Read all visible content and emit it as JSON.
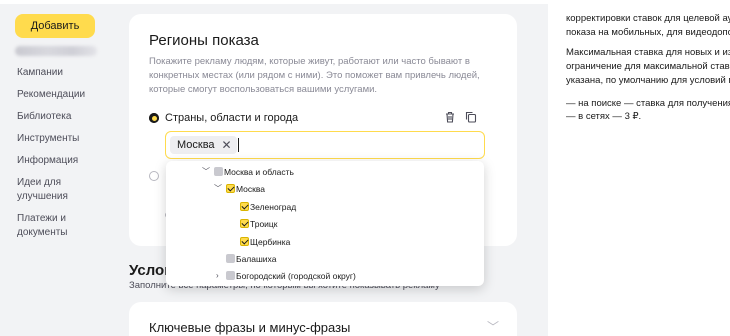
{
  "sidebar": {
    "add_label": "Добавить",
    "nav": [
      "Кампании",
      "Рекомендации",
      "Библиотека",
      "Инструменты",
      "Информация",
      "Идеи для улучшения",
      "Платежи и документы"
    ]
  },
  "regions": {
    "title": "Регионы показа",
    "description": "Покажите рекламу людям, которые живут, работают или часто бывают в конкретных местах (или рядом с ними). Это поможет вам привлечь людей, которые смогут воспользоваться вашими услугами.",
    "option_label": "Страны, области и города",
    "selected_chip": "Москва",
    "icons": [
      "trash-icon",
      "copy-icon"
    ]
  },
  "dropdown": {
    "items": [
      {
        "label": "Москва и область",
        "state": "partial",
        "expand": "open"
      },
      {
        "label": "Москва",
        "state": "checked",
        "expand": "open"
      },
      {
        "label": "Зеленоград",
        "state": "checked",
        "expand": ""
      },
      {
        "label": "Троицк",
        "state": "checked",
        "expand": ""
      },
      {
        "label": "Щербинка",
        "state": "checked",
        "expand": ""
      },
      {
        "label": "Балашиха",
        "state": "unchecked",
        "expand": ""
      },
      {
        "label": "Богородский (городской округ)",
        "state": "unchecked",
        "expand": "closed"
      }
    ]
  },
  "conditions": {
    "title_partial": "Услов",
    "subtitle": "Заполните все параметры, по которым вы хотите показывать рекламу"
  },
  "keywords_card": {
    "title": "Ключевые фразы и минус-фразы"
  },
  "right_panel": {
    "lines": [
      "корректировки ставок для целевой ауд",
      "показа на мобильных, для видеодополн",
      "Максимальная ставка для новых и измен",
      "ограничение для максимальной ставки.",
      "указана, по умолчанию для условий пок",
      "—   на поиске — ставка для получения 9",
      "—   в сетях — 3 ₽."
    ]
  },
  "colors": {
    "accent": "#ffdb4d",
    "background": "#f2f3f5",
    "muted_text": "#8a8a96"
  }
}
